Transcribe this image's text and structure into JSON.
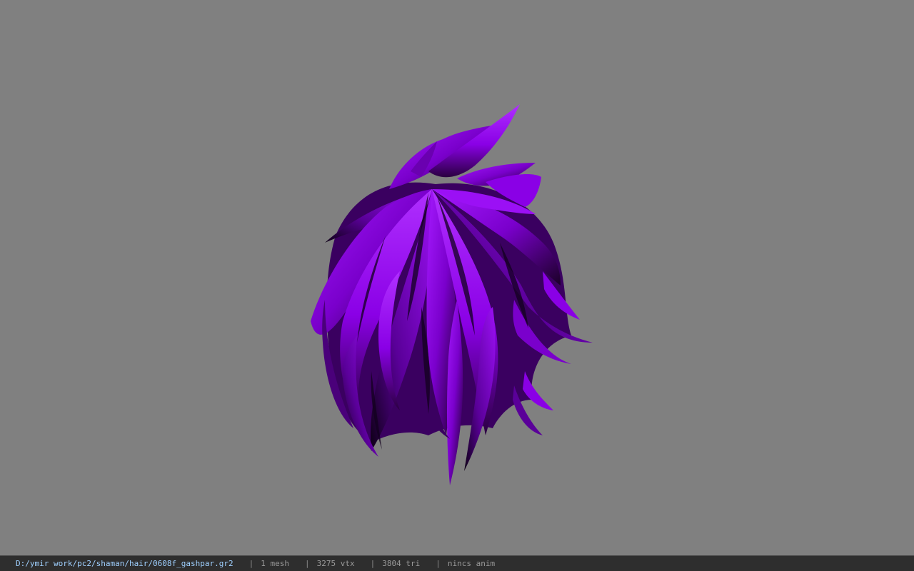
{
  "viewport": {
    "background": "#808080",
    "model": {
      "name": "hair-mesh",
      "primary_color": "#8a00e6",
      "highlight_color": "#a51aff",
      "shadow_color": "#1a0026"
    }
  },
  "status_bar": {
    "file_path": "D:/ymir work/pc2/shaman/hair/0608f_gashpar.gr2",
    "separator": "|",
    "mesh_count": "1 mesh",
    "vertex_count": "3275 vtx",
    "triangle_count": "3804 tri",
    "anim_status": "nincs anim",
    "colors": {
      "path": "#9fd0ff",
      "stats": "#9a9a9a",
      "background": "#2e2e2e"
    }
  }
}
